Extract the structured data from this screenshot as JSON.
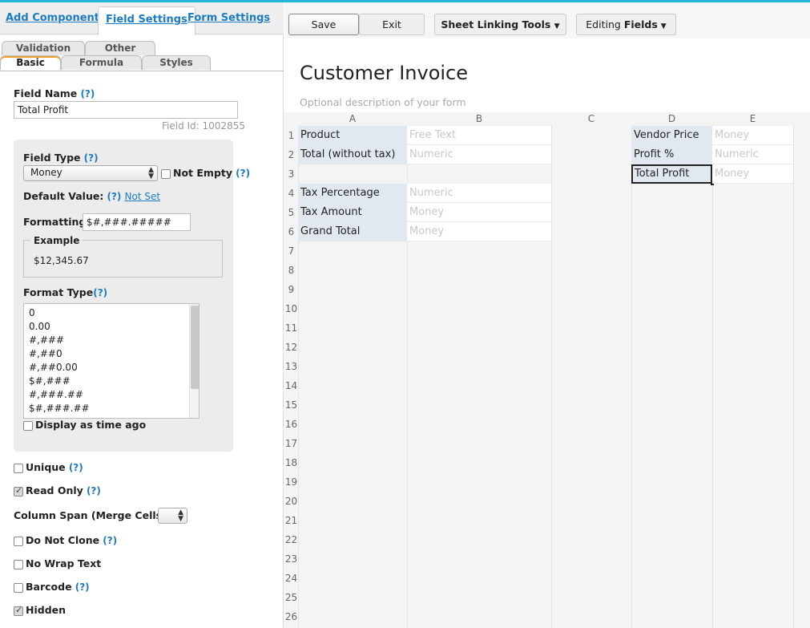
{
  "left_tabs": [
    "Add Components",
    "Field Settings",
    "Form Settings"
  ],
  "sub_tabs": {
    "row1": [
      "Validation",
      "Other"
    ],
    "row2": [
      "Basic",
      "Formula",
      "Styles"
    ]
  },
  "field_name": {
    "label": "Field Name",
    "help": "(?)",
    "value": "Total Profit",
    "field_id": "Field Id: 1002855"
  },
  "field_type": {
    "label": "Field Type",
    "help": "(?)",
    "selected": "Money",
    "not_empty_label": "Not Empty",
    "not_empty_help": "(?)"
  },
  "default_value": {
    "label": "Default Value:",
    "help": "(?)",
    "link": "Not Set"
  },
  "formatting": {
    "label": "Formatting:",
    "value": "$#,###.#####"
  },
  "example": {
    "legend": "Example",
    "value": "$12,345.67"
  },
  "format_type": {
    "label": "Format Type",
    "help": "(?)",
    "items": [
      "0",
      "0.00",
      "#,###",
      "#,##0",
      "#,##0.00",
      "$#,###",
      "#,###.##",
      "$#,###.##"
    ]
  },
  "display_time_ago": "Display as time ago",
  "options": {
    "unique": {
      "label": "Unique",
      "help": "(?)"
    },
    "read_only": {
      "label": "Read Only",
      "help": "(?)"
    },
    "column_span": {
      "label": "Column Span (Merge Cells)",
      "help": "(?)"
    },
    "do_not_clone": {
      "label": "Do Not Clone",
      "help": "(?)"
    },
    "no_wrap": {
      "label": "No Wrap Text"
    },
    "barcode": {
      "label": "Barcode",
      "help": "(?)"
    },
    "hidden": {
      "label": "Hidden"
    }
  },
  "toolbar": {
    "save": "Save",
    "exit": "Exit",
    "sheet_linking": "Sheet Linking Tools",
    "editing_prefix": "Editing",
    "editing_bold": "Fields"
  },
  "form": {
    "title": "Customer Invoice",
    "description": "Optional description of your form"
  },
  "grid": {
    "columns": [
      "A",
      "B",
      "C",
      "D",
      "E"
    ],
    "rows": [
      "1",
      "2",
      "3",
      "4",
      "5",
      "6",
      "7",
      "8",
      "9",
      "10",
      "11",
      "12",
      "13",
      "14",
      "15",
      "16",
      "17",
      "18",
      "19",
      "20",
      "21",
      "22",
      "23",
      "24",
      "25",
      "26"
    ],
    "cells": {
      "a1": "Product",
      "b1": "Free Text",
      "a2": "Total (without tax)",
      "b2": "Numeric",
      "a4": "Tax Percentage",
      "b4": "Numeric",
      "a5": "Tax Amount",
      "b5": "Money",
      "a6": "Grand Total",
      "b6": "Money",
      "d1": "Vendor Price",
      "e1": "Money",
      "d2": "Profit %",
      "e2": "Numeric",
      "d3": "Total Profit",
      "e3": "Money"
    }
  },
  "colors": {
    "accent": "#20b7d6",
    "link": "#1d7bc4",
    "label_cell": "#e2e8ef",
    "tab_highlight": "#f0a030"
  }
}
